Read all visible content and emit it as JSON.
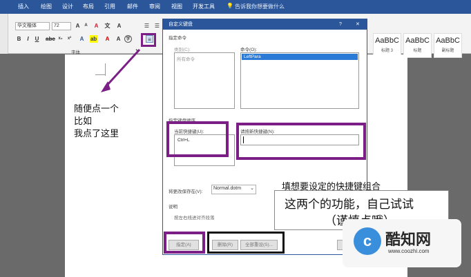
{
  "ribbon": {
    "tabs": [
      "插入",
      "绘图",
      "设计",
      "布局",
      "引用",
      "邮件",
      "审阅",
      "视图",
      "开发工具"
    ],
    "search_placeholder": "告诉我你想要做什么",
    "font_name": "华文楷体",
    "font_size": "72",
    "group_label": "字体",
    "style_preview": [
      "AaBbC",
      "AaBbC",
      "AaBbC"
    ],
    "style_names": [
      "标题 3",
      "标题",
      "副标题"
    ]
  },
  "document": {
    "note_lines": [
      "随便点一个",
      "比如",
      "我点了这里"
    ],
    "annotation_fill": "填想要设定的快捷键组合",
    "annotation_box_line1": "这两个的功能，自己试试",
    "annotation_box_line2": "（谨慎点哦）"
  },
  "dialog": {
    "title": "自定义键盘",
    "help": "?",
    "close": "✕",
    "specify_command": "指定命令",
    "categories_label": "类别(C):",
    "categories_item": "所有命令",
    "commands_label": "命令(O):",
    "commands_selected": "LeftPara",
    "key_sequence_section": "指定键盘顺序",
    "current_keys_label": "当前快捷键(U):",
    "current_key_value": "Ctrl+L",
    "new_key_label": "请按新快捷键(N):",
    "save_in_label": "将更改保存在(V):",
    "save_in_value": "Normal.dotm",
    "description_label": "说明",
    "description_text": "按左右线进对齐段落",
    "assign_button": "指定(A)",
    "remove_button": "删除(R)",
    "reset_all_button": "全部重设(S)...",
    "close_button": "关"
  },
  "watermark": {
    "brand": "酷知网",
    "url": "www.coozhi.com"
  },
  "colors": {
    "annotation_purple": "#7b1f86",
    "word_blue": "#2b579a"
  }
}
